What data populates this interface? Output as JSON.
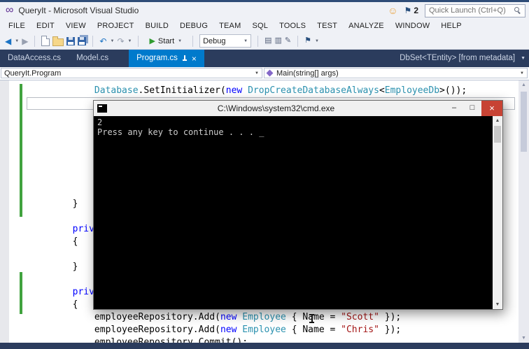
{
  "window": {
    "title": "QueryIt - Microsoft Visual Studio",
    "notifications_count": "2",
    "quick_launch_placeholder": "Quick Launch (Ctrl+Q)"
  },
  "menu": [
    "FILE",
    "EDIT",
    "VIEW",
    "PROJECT",
    "BUILD",
    "DEBUG",
    "TEAM",
    "SQL",
    "TOOLS",
    "TEST",
    "ANALYZE",
    "WINDOW",
    "HELP"
  ],
  "toolbar": {
    "start_label": "Start",
    "debug_target": "Debug"
  },
  "tabs": [
    {
      "label": "DataAccess.cs",
      "active": false,
      "gap_before": false
    },
    {
      "label": "Model.cs",
      "active": false,
      "gap_before": false
    },
    {
      "label": "Program.cs",
      "active": true,
      "gap_before": true
    }
  ],
  "right_tab": {
    "label": "DbSet<TEntity> [from metadata]"
  },
  "navbar": {
    "type": "QueryIt.Program",
    "member": "Main(string[] args)"
  },
  "console": {
    "title": "C:\\Windows\\system32\\cmd.exe",
    "lines": [
      "2",
      "Press any key to continue . . . _"
    ]
  },
  "code": {
    "lines": [
      {
        "row": 0,
        "tokens": [
          [
            "            ",
            "p"
          ],
          [
            "Database",
            "t"
          ],
          [
            ".SetInitializer(",
            "p"
          ],
          [
            "new",
            "k"
          ],
          [
            " ",
            "p"
          ],
          [
            "DropCreateDatabaseAlways",
            "t"
          ],
          [
            "<",
            "p"
          ],
          [
            "EmployeeDb",
            "t"
          ],
          [
            ">());",
            "p"
          ]
        ]
      },
      {
        "row": 9,
        "tokens": [
          [
            "        }",
            "p"
          ]
        ]
      },
      {
        "row": 11,
        "tokens": [
          [
            "        ",
            "p"
          ],
          [
            "private",
            "k"
          ]
        ]
      },
      {
        "row": 12,
        "tokens": [
          [
            "        {",
            "p"
          ]
        ]
      },
      {
        "row": 14,
        "tokens": [
          [
            "        }",
            "p"
          ]
        ]
      },
      {
        "row": 16,
        "tokens": [
          [
            "        ",
            "p"
          ],
          [
            "private",
            "k"
          ]
        ]
      },
      {
        "row": 17,
        "tokens": [
          [
            "        {",
            "p"
          ]
        ]
      },
      {
        "row": 18,
        "tokens": [
          [
            "            employeeRepository.Add(",
            "p"
          ],
          [
            "new",
            "k"
          ],
          [
            " ",
            "p"
          ],
          [
            "Employee",
            "t"
          ],
          [
            " { Name = ",
            "p"
          ],
          [
            "\"Scott\"",
            "s"
          ],
          [
            " });",
            "p"
          ]
        ]
      },
      {
        "row": 19,
        "tokens": [
          [
            "            employeeRepository.Add(",
            "p"
          ],
          [
            "new",
            "k"
          ],
          [
            " ",
            "p"
          ],
          [
            "Employee",
            "t"
          ],
          [
            " { Name = ",
            "p"
          ],
          [
            "\"Chris\"",
            "s"
          ],
          [
            " });",
            "p"
          ]
        ]
      },
      {
        "row": 20,
        "tokens": [
          [
            "            employeeRepository.Commit();",
            "p"
          ]
        ]
      }
    ]
  },
  "icons": {
    "logo": "∞",
    "smiley": "☺",
    "flag": "⚑",
    "back": "◀",
    "forward": "▶",
    "undo": "↶",
    "redo": "↷",
    "play": "▶",
    "caret": "▼",
    "up": "▲",
    "down": "▼",
    "bookmark": "⚑",
    "minimize": "–",
    "maximize": "□",
    "close": "×",
    "panel1": "▤",
    "panel2": "▥",
    "edit": "✎"
  },
  "colors": {
    "accent": "#007ACC",
    "keyword_blue": "#0000FF",
    "type_teal": "#2B91AF",
    "string_red": "#A31515",
    "tab_strip": "#2B3C5D",
    "console_close_red": "#C74334",
    "change_bar_green": "#41A33F"
  }
}
